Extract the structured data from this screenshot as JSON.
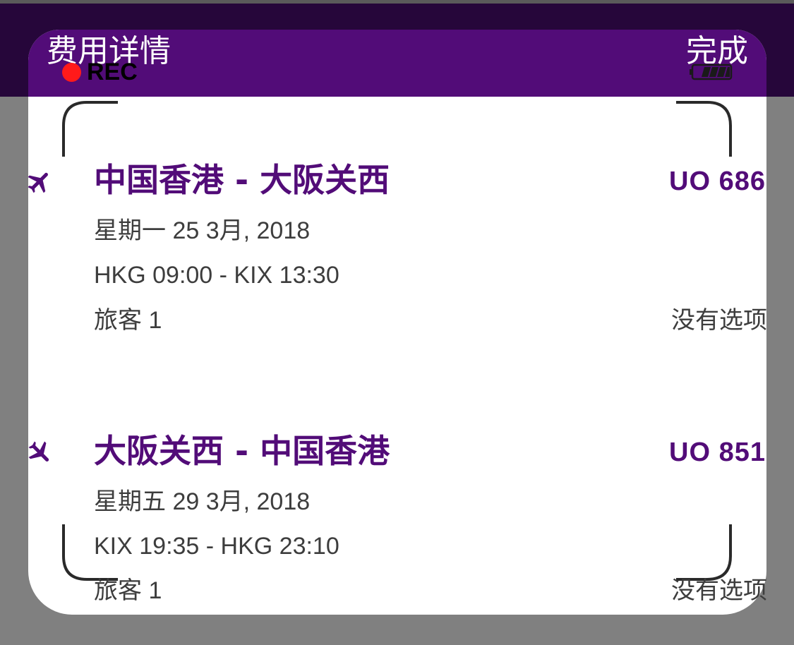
{
  "header": {
    "title": "费用详情",
    "done_label": "完成"
  },
  "camera_overlay": {
    "rec_label": "REC",
    "battery_icon": "battery-icon"
  },
  "flights": [
    {
      "route": "中国香港 - 大阪关西",
      "flight_number": "UO 686",
      "date": "星期一 25 3月, 2018",
      "times": "HKG 09:00 - KIX 13:30",
      "passengers": "旅客 1",
      "options": "没有选项"
    },
    {
      "route": "大阪关西 - 中国香港",
      "flight_number": "UO 851",
      "date": "星期五 29 3月, 2018",
      "times": "KIX 19:35 - HKG 23:10",
      "passengers": "旅客 1",
      "options": "没有选项"
    }
  ],
  "colors": {
    "brand_purple": "#520c78",
    "header_dark": "#26063a",
    "background_gray": "#808080",
    "rec_red": "#ff1a1a"
  }
}
